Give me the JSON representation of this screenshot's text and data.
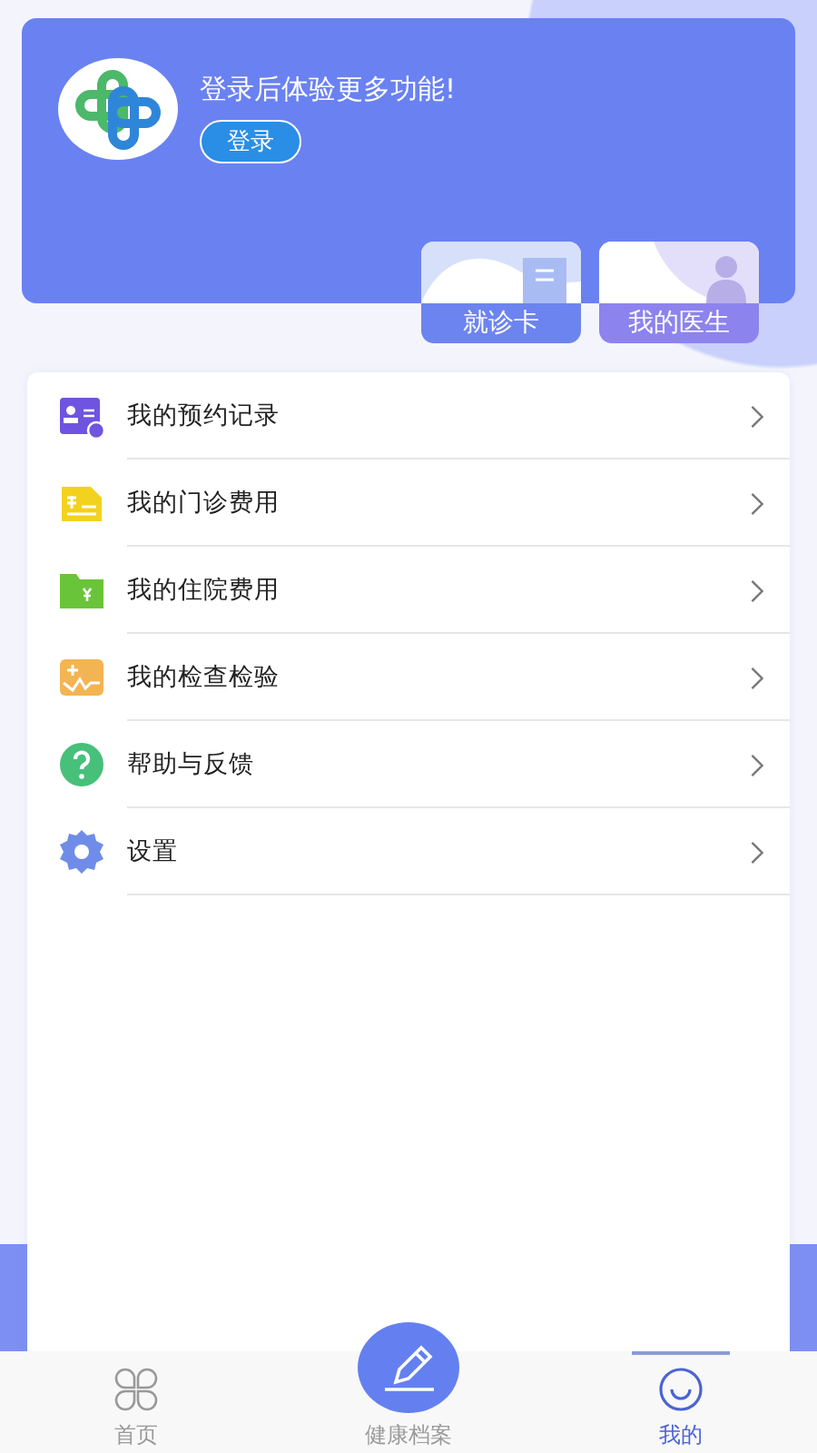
{
  "header": {
    "title": "登录后体验更多功能!",
    "login_button": "登录",
    "cards": [
      {
        "kind": "card",
        "label": "就诊卡"
      },
      {
        "kind": "doctor",
        "label": "我的医生"
      }
    ]
  },
  "menu": [
    {
      "kind": "appointment",
      "label": "我的预约记录"
    },
    {
      "kind": "outpatient",
      "label": "我的门诊费用"
    },
    {
      "kind": "inpatient",
      "label": "我的住院费用"
    },
    {
      "kind": "exam",
      "label": "我的检查检验"
    },
    {
      "kind": "help",
      "label": "帮助与反馈"
    },
    {
      "kind": "settings",
      "label": "设置"
    }
  ],
  "tabs": [
    {
      "kind": "home",
      "label": "首页",
      "selected": false
    },
    {
      "kind": "records",
      "label": "健康档案",
      "selected": false
    },
    {
      "kind": "mine",
      "label": "我的",
      "selected": true
    }
  ]
}
